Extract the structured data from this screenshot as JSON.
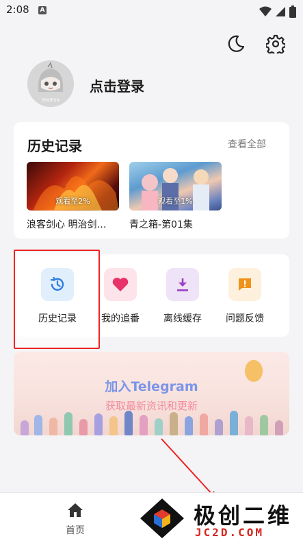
{
  "status_bar": {
    "time": "2:08",
    "sim_badge": "A"
  },
  "profile": {
    "login_text": "点击登录",
    "avatar_text": "EMOFUN"
  },
  "history": {
    "title": "历史记录",
    "view_all": "查看全部",
    "items": [
      {
        "progress": "观看至2%",
        "title": "浪客剑心 明治剑…"
      },
      {
        "progress": "观看至1%",
        "title": "青之箱-第01集"
      }
    ]
  },
  "menu": {
    "items": [
      {
        "label": "历史记录",
        "icon": "history-icon",
        "color": "#2f7de1"
      },
      {
        "label": "我的追番",
        "icon": "heart-icon",
        "color": "#e8326a"
      },
      {
        "label": "离线缓存",
        "icon": "download-icon",
        "color": "#9c3fc4"
      },
      {
        "label": "问题反馈",
        "icon": "feedback-icon",
        "color": "#f0921a"
      }
    ]
  },
  "banner": {
    "title": "加入Telegram",
    "subtitle": "获取最新资讯和更新"
  },
  "bottom_nav": {
    "home": "首页"
  },
  "watermark": {
    "text": "极创二维",
    "sub": "JC2D.COM"
  },
  "colors": {
    "highlight": "#e22222",
    "accent_blue": "#7b95e8"
  }
}
